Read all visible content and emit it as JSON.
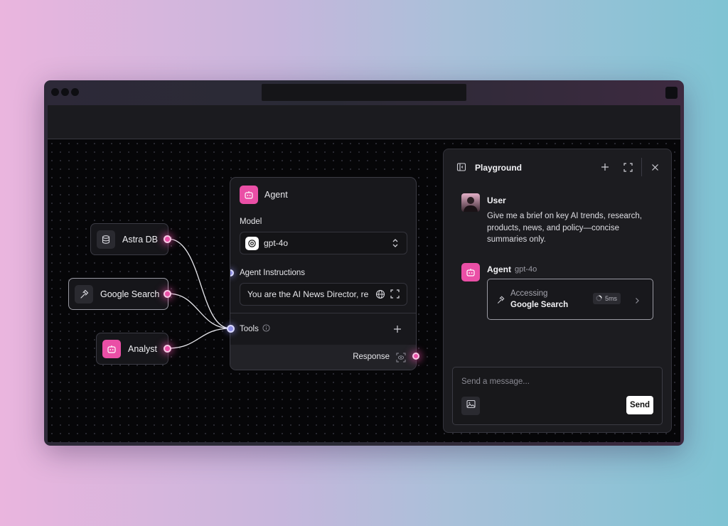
{
  "nodes": {
    "astra": {
      "label": "Astra DB",
      "icon": "database-icon"
    },
    "google": {
      "label": "Google Search",
      "icon": "hammer-icon"
    },
    "analyst": {
      "label": "Analyst",
      "icon": "bot-icon"
    }
  },
  "agent": {
    "title": "Agent",
    "model_label": "Model",
    "model_value": "gpt-4o",
    "instructions_label": "Agent Instructions",
    "instructions_value": "You are the AI News Director, re",
    "tools_label": "Tools",
    "response_label": "Response"
  },
  "playground": {
    "title": "Playground",
    "user_name": "User",
    "user_message": "Give me a brief on key AI trends, research, products, news, and policy—concise summaries only.",
    "agent_name": "Agent",
    "agent_model": "gpt-4o",
    "tool_status": "Accessing",
    "tool_name": "Google Search",
    "tool_time": "5ms",
    "input_placeholder": "Send a message...",
    "send_label": "Send"
  },
  "colors": {
    "accent": "#ea4fa6",
    "background_gradient_start": "#eab5de",
    "background_gradient_end": "#7fc3d3"
  }
}
